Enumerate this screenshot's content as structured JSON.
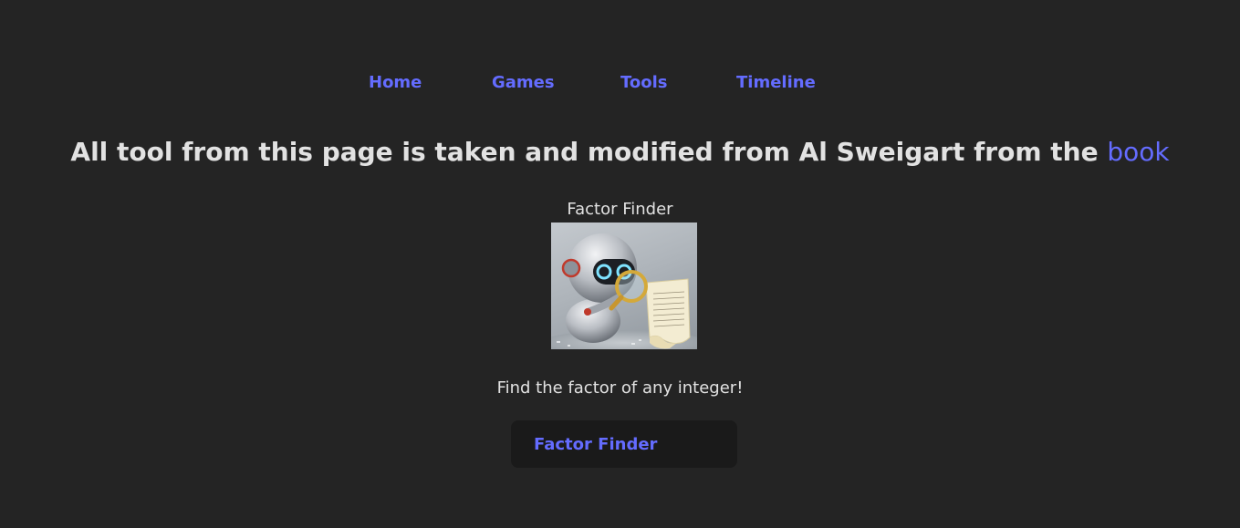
{
  "nav": {
    "items": [
      {
        "label": "Home"
      },
      {
        "label": "Games"
      },
      {
        "label": "Tools"
      },
      {
        "label": "Timeline"
      }
    ]
  },
  "header": {
    "text": "All tool from this page is taken and modified from Al Sweigart from the ",
    "link_label": "book"
  },
  "tool": {
    "title": "Factor Finder",
    "image_alt": "robot-with-magnifying-glass",
    "description": "Find the factor of any integer!",
    "button_label": "Factor Finder"
  },
  "colors": {
    "background": "#242424",
    "accent": "#646cff",
    "button_bg": "#1a1a1a",
    "text": "#dedede"
  }
}
